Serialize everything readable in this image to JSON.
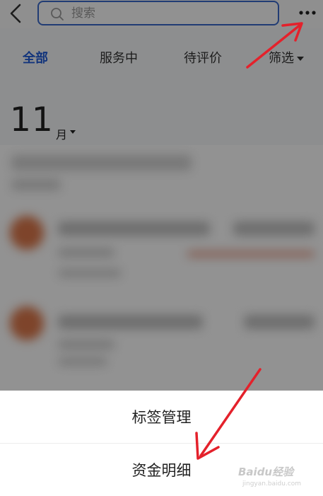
{
  "header": {
    "search_placeholder": "搜索"
  },
  "tabs": [
    {
      "label": "全部",
      "active": true
    },
    {
      "label": "服务中",
      "active": false
    },
    {
      "label": "待评价",
      "active": false
    },
    {
      "label": "筛选",
      "active": false
    }
  ],
  "month": {
    "number": "11",
    "unit": "月"
  },
  "sheet": {
    "items": [
      "标签管理",
      "资金明细"
    ]
  },
  "watermark": {
    "brand": "Baidu经验",
    "url": "jingyan.baidu.com"
  },
  "colors": {
    "accent": "#1f5bd6",
    "arrow": "#e4212b"
  }
}
